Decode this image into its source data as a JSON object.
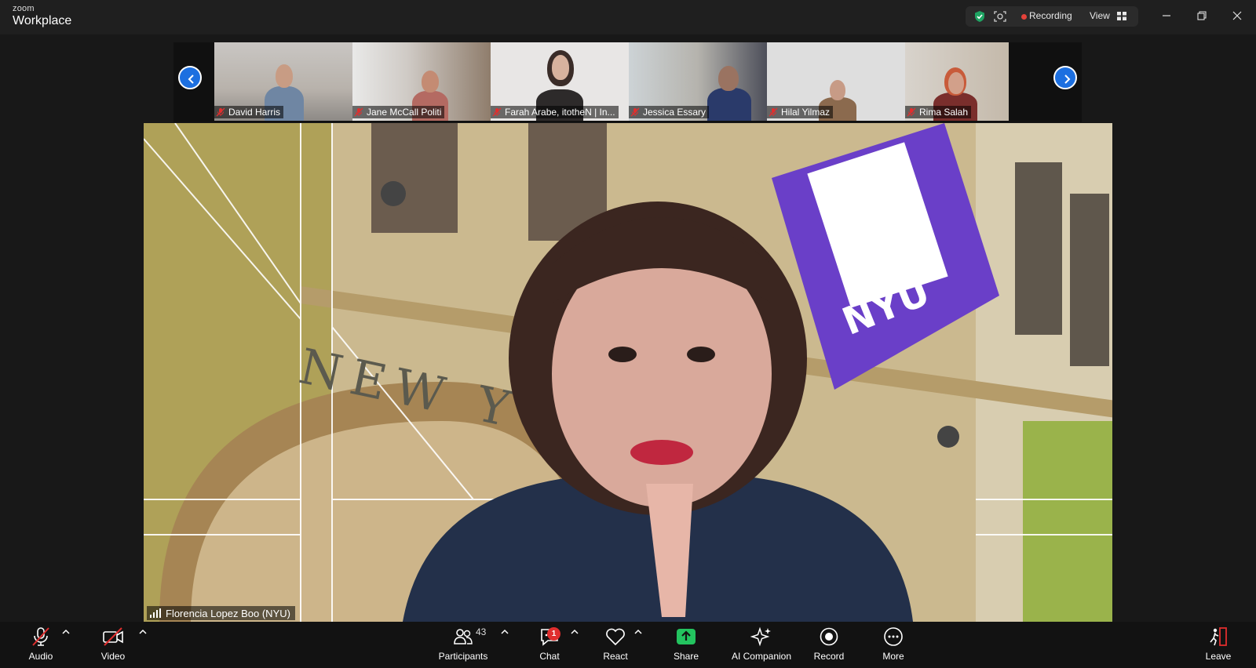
{
  "app": {
    "brand_small": "zoom",
    "brand_name": "Workplace"
  },
  "status_bar": {
    "recording_label": "Recording",
    "view_label": "View",
    "recording_color": "#e4423a",
    "secure_color": "#1fa463"
  },
  "window_controls": [
    "minimize-icon",
    "restore-icon",
    "close-icon"
  ],
  "gallery": {
    "participants": [
      {
        "name": "David Harris",
        "muted": true
      },
      {
        "name": "Jane McCall Politi",
        "muted": true
      },
      {
        "name": "Farah Arabe, itotheN | In...",
        "muted": true
      },
      {
        "name": "Jessica Essary",
        "muted": true
      },
      {
        "name": "Hilal Yilmaz",
        "muted": true
      },
      {
        "name": "Rima Salah",
        "muted": true
      }
    ],
    "nav_color": "#1c6fe0"
  },
  "speaker": {
    "name": "Florencia Lopez Boo (NYU)",
    "background_text": "NEW YO",
    "flag_text": "NYU",
    "flag_color": "#6a3fc8"
  },
  "toolbar": {
    "audio_label": "Audio",
    "video_label": "Video",
    "participants_label": "Participants",
    "participants_count": "43",
    "chat_label": "Chat",
    "chat_badge": "1",
    "react_label": "React",
    "share_label": "Share",
    "ai_label": "AI Companion",
    "record_label": "Record",
    "more_label": "More",
    "leave_label": "Leave",
    "share_color": "#23c35f",
    "leave_color": "#e02e2e"
  }
}
